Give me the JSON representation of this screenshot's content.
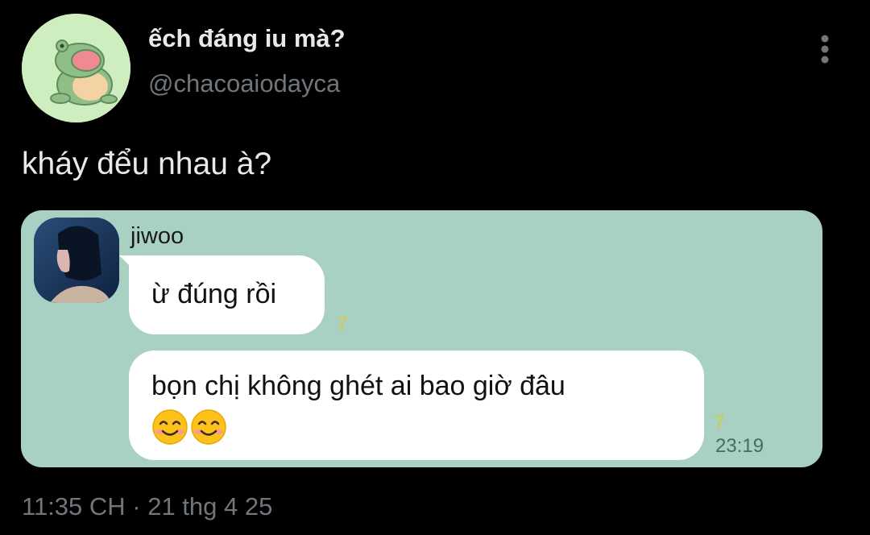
{
  "tweet": {
    "display_name": "ếch đáng iu mà?",
    "handle": "@chacoaiodayca",
    "text": "kháy đểu nhau à?",
    "timestamp": "11:35 CH · 21 thg 4 25"
  },
  "chat": {
    "sender": "jiwoo",
    "messages": [
      {
        "text": "ừ đúng rồi",
        "read_count": "7"
      },
      {
        "text": "bọn chị không ghét ai bao giờ đâu",
        "emojis": "😊😊",
        "read_count": "7",
        "time": "23:19"
      }
    ]
  },
  "colors": {
    "background": "#000000",
    "text_primary": "#e7e9ea",
    "text_secondary": "#71767b",
    "chat_background": "#a8d1c4",
    "bubble": "#ffffff",
    "read_count": "#d7c93a"
  },
  "icons": {
    "more": "more-vertical-icon",
    "avatar": "frog-avatar"
  }
}
